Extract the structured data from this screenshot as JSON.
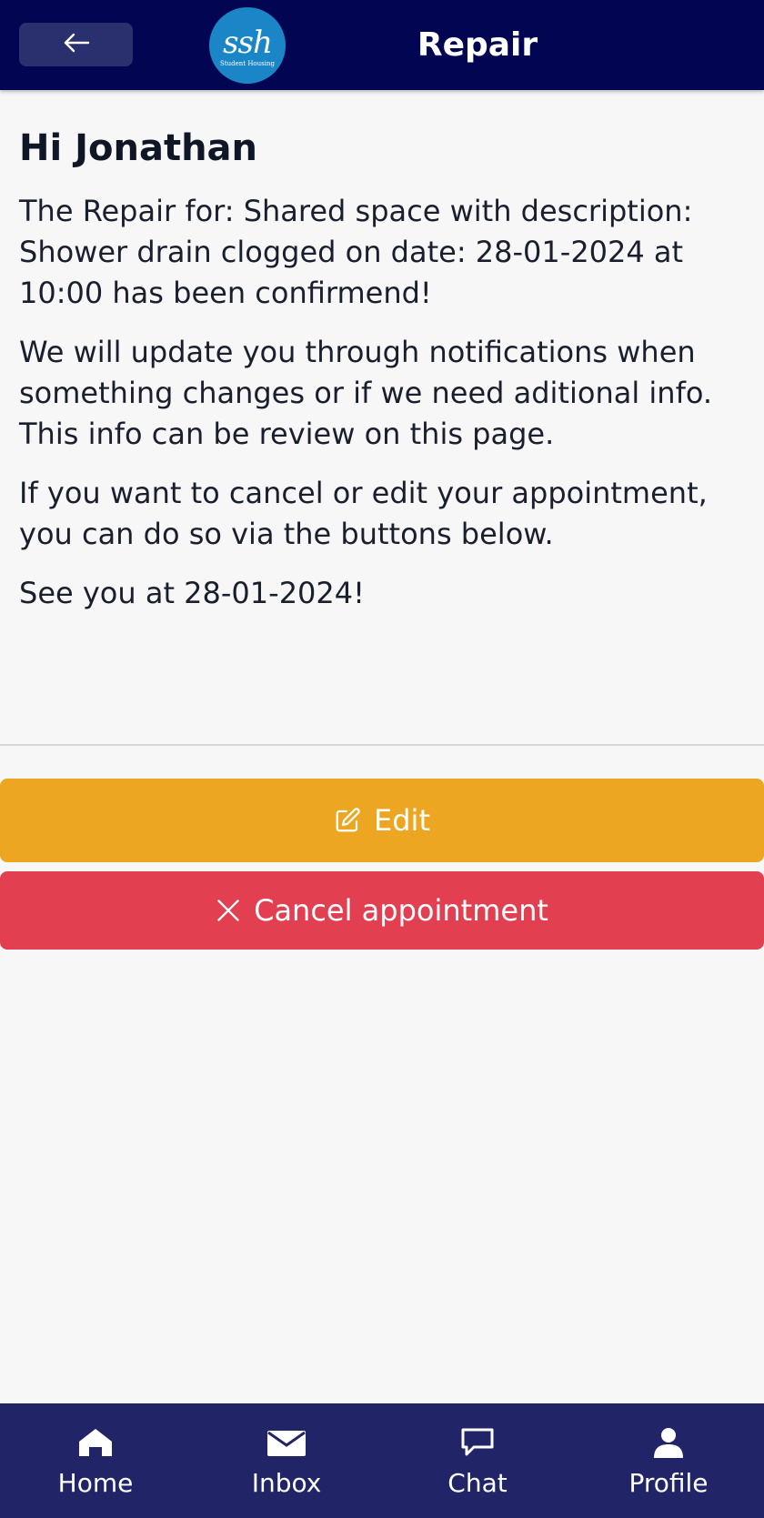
{
  "header": {
    "back_icon": "arrow-left-icon",
    "logo_text": "ssh",
    "logo_subtext": "Student Housing",
    "title": "Repair"
  },
  "main": {
    "greeting": "Hi Jonathan",
    "paragraphs": [
      "The Repair for: Shared space with description: Shower drain clogged on date: 28-01-2024 at 10:00 has been confirmend!",
      "We will update you through notifications when something changes or if we need aditional info. This info can be review on this page.",
      "If you want to cancel or edit your appointment, you can do so via the buttons below.",
      "See you at 28-01-2024!"
    ]
  },
  "actions": {
    "edit_label": "Edit",
    "edit_icon": "edit-icon",
    "cancel_label": "Cancel appointment",
    "cancel_icon": "close-icon"
  },
  "nav": {
    "items": [
      {
        "label": "Home",
        "icon": "home-icon"
      },
      {
        "label": "Inbox",
        "icon": "mail-icon"
      },
      {
        "label": "Chat",
        "icon": "chat-icon"
      },
      {
        "label": "Profile",
        "icon": "user-icon"
      }
    ]
  },
  "colors": {
    "header_bg": "#020652",
    "nav_bg": "#212467",
    "edit_bg": "#eca621",
    "cancel_bg": "#e23f51",
    "logo_bg": "#1a86c8"
  }
}
